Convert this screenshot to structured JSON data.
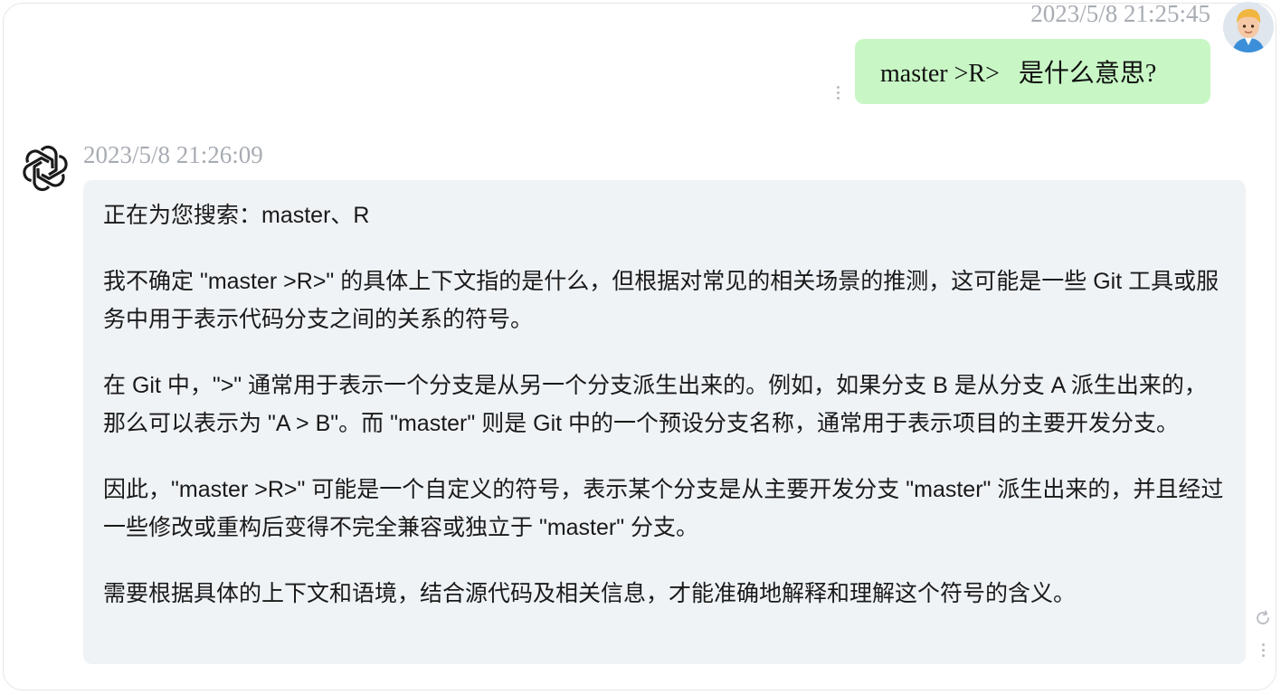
{
  "user_message": {
    "timestamp": "2023/5/8 21:25:45",
    "text": "master >R>   是什么意思?",
    "avatar": "cartoon-user-avatar",
    "bubble_color": "#c8f7c5"
  },
  "assistant_message": {
    "timestamp": "2023/5/8 21:26:09",
    "avatar": "openai-logo-icon",
    "bubble_color": "#f0f3f6",
    "paragraphs": [
      "正在为您搜索：master、R",
      "我不确定 \"master >R>\" 的具体上下文指的是什么，但根据对常见的相关场景的推测，这可能是一些 Git 工具或服务中用于表示代码分支之间的关系的符号。",
      "在 Git 中，\">\" 通常用于表示一个分支是从另一个分支派生出来的。例如，如果分支 B 是从分支 A 派生出来的，那么可以表示为 \"A > B\"。而 \"master\" 则是 Git 中的一个预设分支名称，通常用于表示项目的主要开发分支。",
      "因此，\"master >R>\" 可能是一个自定义的符号，表示某个分支是从主要开发分支 \"master\" 派生出来的，并且经过一些修改或重构后变得不完全兼容或独立于 \"master\" 分支。",
      "需要根据具体的上下文和语境，结合源代码及相关信息，才能准确地解释和理解这个符号的含义。"
    ]
  },
  "icons": {
    "message_menu": "kebab-menu-icon",
    "regenerate": "refresh-icon"
  }
}
